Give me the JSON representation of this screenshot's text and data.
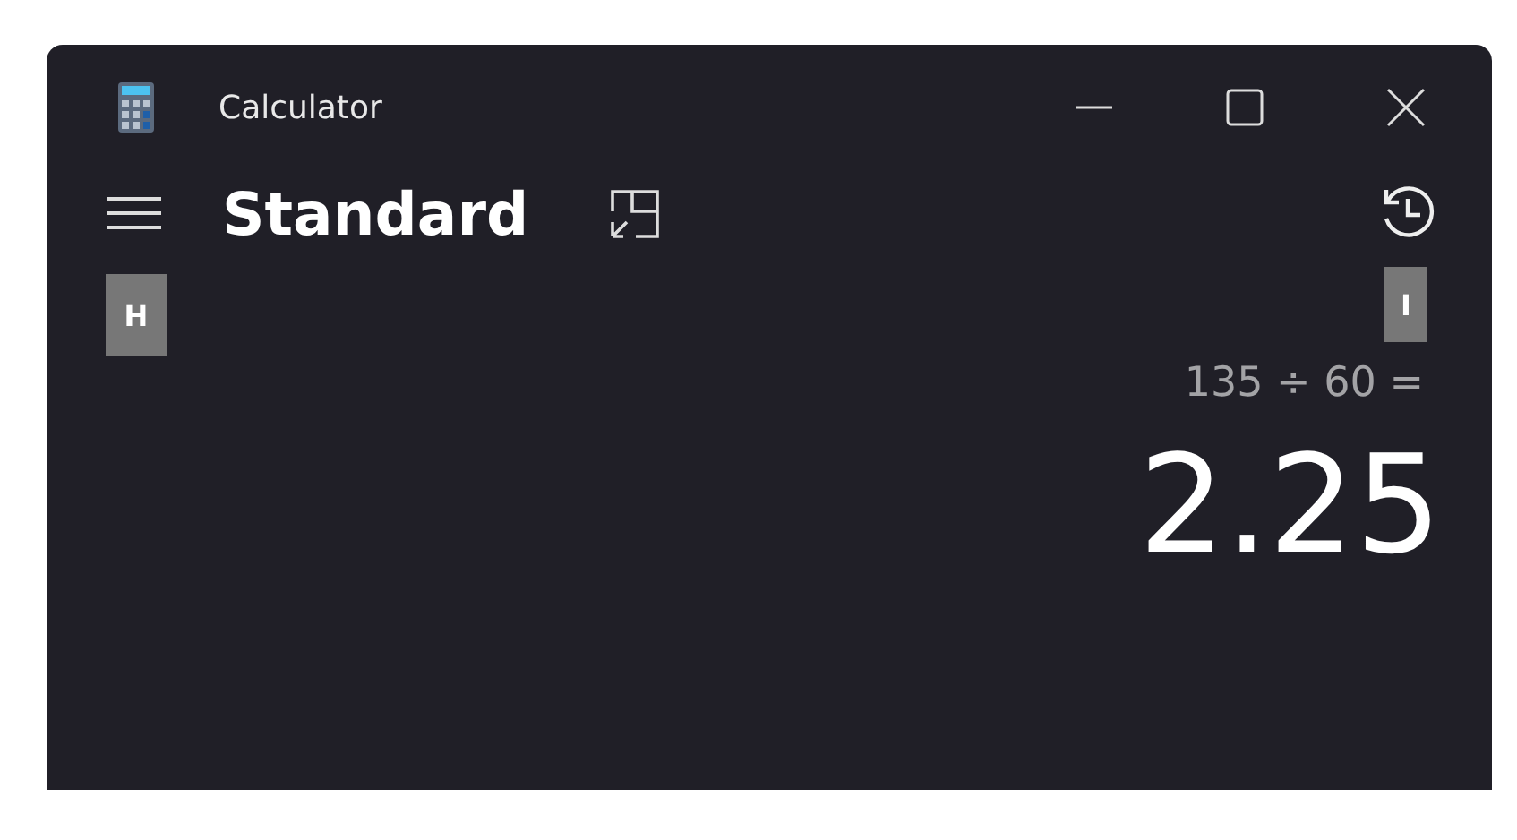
{
  "window": {
    "title": "Calculator"
  },
  "header": {
    "mode": "Standard"
  },
  "key_tips": [
    "H",
    "I"
  ],
  "display": {
    "expression": "135 ÷ 60 =",
    "result": "2.25"
  }
}
